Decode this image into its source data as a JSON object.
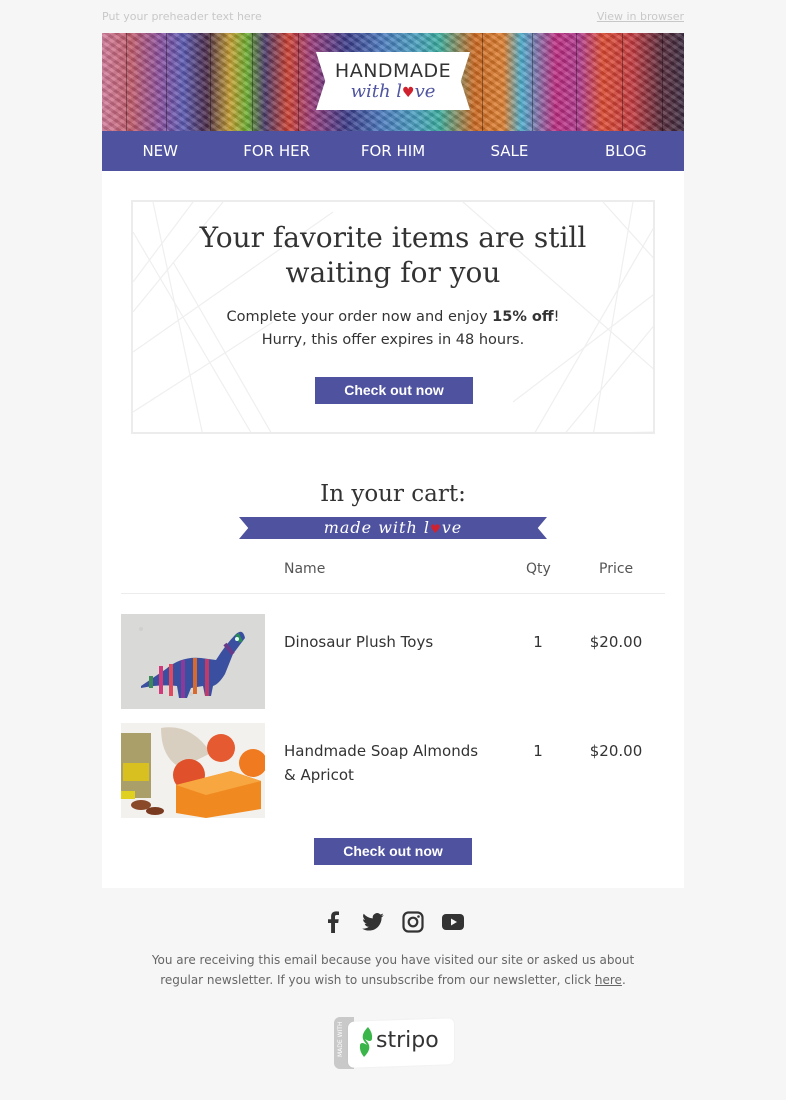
{
  "preheader": {
    "text": "Put your preheader text here",
    "view_in_browser": "View in browser"
  },
  "logo": {
    "line1": "HANDMADE",
    "line2_prefix": "with l",
    "heart": "♥",
    "line2_suffix": "ve"
  },
  "nav": {
    "items": [
      "NEW",
      "FOR HER",
      "FOR HIM",
      "SALE",
      "BLOG"
    ]
  },
  "hero": {
    "title_line1": "Your favorite items are still",
    "title_line2": "waiting for you",
    "sub_line1_prefix": "Complete your order now and enjoy ",
    "sub_line1_bold": "15% off",
    "sub_line1_suffix": "!",
    "sub_line2": "Hurry, this offer expires in 48 hours.",
    "button": "Check out now"
  },
  "cart": {
    "title": "In your cart:",
    "ribbon_prefix": "made with l",
    "ribbon_heart": "♥",
    "ribbon_suffix": "ve",
    "columns": {
      "name": "Name",
      "qty": "Qty",
      "price": "Price"
    },
    "items": [
      {
        "name": "Dinosaur Plush Toys",
        "qty": "1",
        "price": "$20.00",
        "image": "dinosaur-plush-toy"
      },
      {
        "name": "Handmade Soap Almonds & Apricot",
        "qty": "1",
        "price": "$20.00",
        "image": "soap-apricot"
      }
    ],
    "button": "Check out now"
  },
  "social": {
    "icons": [
      "facebook-icon",
      "twitter-icon",
      "instagram-icon",
      "youtube-icon"
    ]
  },
  "footer": {
    "text_prefix": "You are receiving this email because you have visited our site or asked us about regular newsletter. If you wish to unsubscribe from our newsletter, click ",
    "link": "here",
    "text_suffix": "."
  },
  "badge": {
    "made_with": "MADE WITH",
    "brand": "stripo"
  },
  "colors": {
    "accent": "#4f539f",
    "heart": "#d0222e",
    "stripo_green": "#3ab54a"
  }
}
